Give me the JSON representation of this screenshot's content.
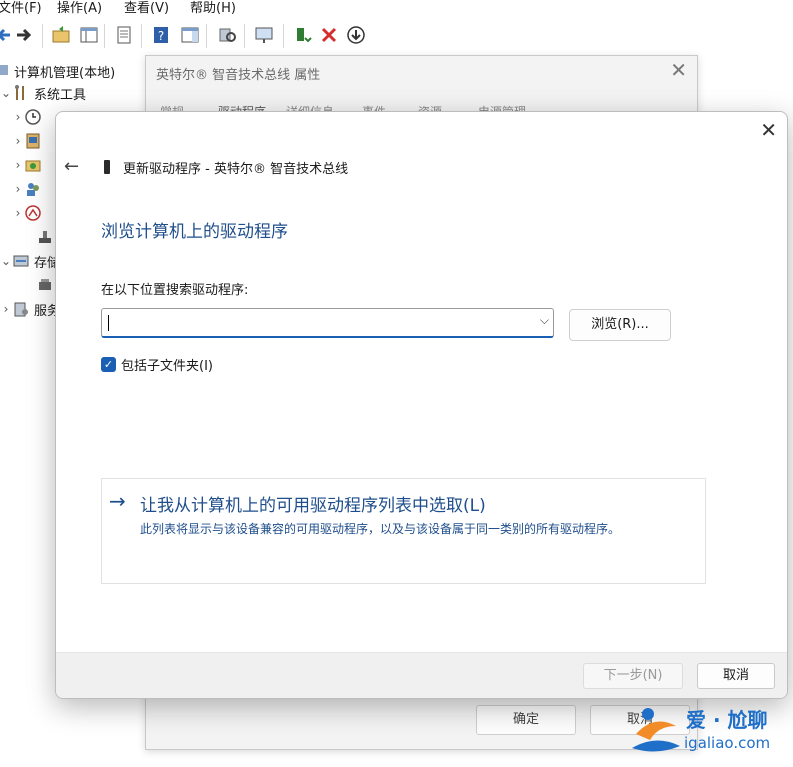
{
  "menu": [
    "文件(F)",
    "操作(A)",
    "查看(V)",
    "帮助(H)"
  ],
  "tree": {
    "root": "计算机管理(本地)",
    "system_tools": "系统工具",
    "storage": "存储",
    "services": "服务"
  },
  "properties_dialog": {
    "title": "英特尔® 智音技术总线 属性",
    "tabs": [
      "常规",
      "驱动程序",
      "详细信息",
      "事件",
      "资源",
      "电源管理"
    ],
    "ok_label": "确定",
    "cancel_label": "取消"
  },
  "wizard": {
    "title": "更新驱动程序 - 英特尔® 智音技术总线",
    "heading": "浏览计算机上的驱动程序",
    "search_label": "在以下位置搜索驱动程序:",
    "path_value": "",
    "browse_label": "浏览(R)...",
    "include_subfolders_label": "包括子文件夹(I)",
    "include_subfolders_checked": true,
    "pick_title": "让我从计算机上的可用驱动程序列表中选取(L)",
    "pick_desc": "此列表将显示与该设备兼容的可用驱动程序，以及与该设备属于同一类别的所有驱动程序。",
    "next_label": "下一步(N)",
    "cancel_label": "取消"
  },
  "watermark": {
    "text": "爱 · 尬聊",
    "url": "igaliao.com"
  },
  "colors": {
    "accent": "#1a5fb4",
    "link": "#1f4e8c",
    "watermark": "#1f6fc9"
  }
}
